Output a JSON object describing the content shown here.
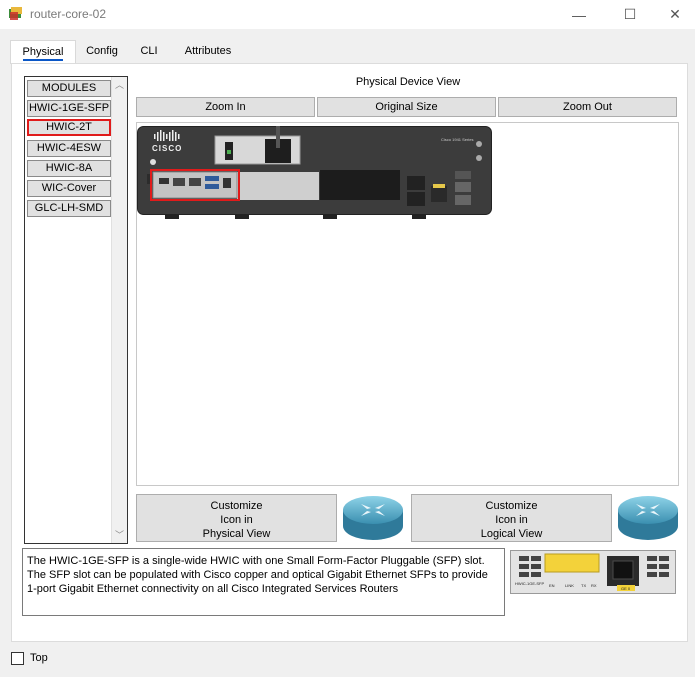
{
  "window": {
    "title": "router-core-02",
    "minimize": "—",
    "maximize": "☐",
    "close": "✕"
  },
  "tabs": [
    {
      "label": "Physical",
      "active": true
    },
    {
      "label": "Config"
    },
    {
      "label": "CLI"
    },
    {
      "label": "Attributes"
    }
  ],
  "modules": {
    "items": [
      {
        "label": "MODULES"
      },
      {
        "label": "HWIC-1GE-SFP"
      },
      {
        "label": "HWIC-2T",
        "selected": true
      },
      {
        "label": "HWIC-4ESW"
      },
      {
        "label": "HWIC-8A"
      },
      {
        "label": "WIC-Cover"
      },
      {
        "label": "GLC-LH-SMD"
      }
    ]
  },
  "physical_view": {
    "title": "Physical Device View",
    "zoom_in": "Zoom In",
    "original_size": "Original Size",
    "zoom_out": "Zoom Out",
    "device": {
      "brand": "CISCO",
      "series": "Cisco 1941 Series"
    }
  },
  "customize": {
    "physical": {
      "line1": "Customize",
      "line2": "Icon in",
      "line3": "Physical View"
    },
    "logical": {
      "line1": "Customize",
      "line2": "Icon in",
      "line3": "Logical View"
    }
  },
  "description": "The HWIC-1GE-SFP is a single-wide HWIC with one Small Form-Factor Pluggable (SFP) slot. The SFP slot can be populated with Cisco copper and optical Gigabit Ethernet SFPs to provide 1-port Gigabit Ethernet connectivity on all Cisco Integrated Services Routers",
  "module_image": {
    "name": "HWIC-1GE-SFP",
    "labels": [
      "EN",
      "LINK",
      "TX",
      "RX"
    ],
    "port": "GE 0"
  },
  "footer": {
    "top_label": "Top"
  },
  "colors": {
    "accent_tab": "#0a57c7",
    "selection": "#e01b1b"
  }
}
